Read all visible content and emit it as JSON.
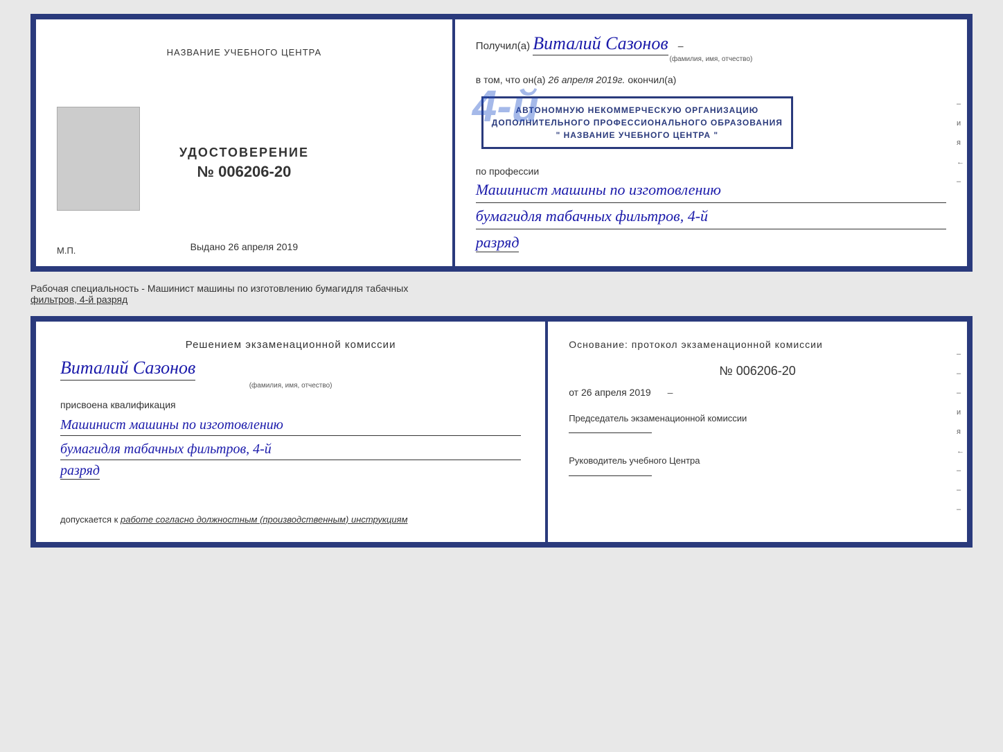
{
  "top": {
    "left": {
      "center_title": "НАЗВАНИЕ УЧЕБНОГО ЦЕНТРА",
      "udostoverenie": "УДОСТОВЕРЕНИЕ",
      "number_prefix": "№",
      "number": "006206-20",
      "issued_label": "Выдано",
      "issued_date": "26 апреля 2019",
      "mp_label": "М.П."
    },
    "right": {
      "poluchil_prefix": "Получил(а)",
      "name": "Виталий Сазонов",
      "fio_label": "(фамилия, имя, отчество)",
      "vtom_prefix": "в том, что он(а)",
      "date_value": "26 апреля 2019г.",
      "okonchil": "окончил(а)",
      "stamp_line1": "АВТОНОМНУЮ НЕКОММЕРЧЕСКУЮ ОРГАНИЗАЦИЮ",
      "stamp_line2": "ДОПОЛНИТЕЛЬНОГО ПРОФЕССИОНАЛЬНОГО ОБРАЗОВАНИЯ",
      "stamp_line3": "\" НАЗВАНИЕ УЧЕБНОГО ЦЕНТРА \"",
      "big_number": "4-й",
      "po_professii": "по профессии",
      "profession_line1": "Машинист машины по изготовлению",
      "profession_line2": "бумагидля табачных фильтров, 4-й",
      "razryad": "разряд",
      "side_chars": [
        "–",
        "и",
        "я",
        "←",
        "–"
      ]
    }
  },
  "bottom_label": {
    "text": "Рабочая специальность - Машинист машины по изготовлению бумагидля табачных",
    "underline_part": "фильтров, 4-й разряд"
  },
  "bottom": {
    "left": {
      "resheniem": "Решением экзаменационной комиссии",
      "name": "Виталий Сазонов",
      "fio_label": "(фамилия, имя, отчество)",
      "prisvoena": "присвоена квалификация",
      "profession_line1": "Машинист машины по изготовлению",
      "profession_line2": "бумагидля табачных фильтров, 4-й",
      "razryad": "разряд",
      "dopusk_prefix": "допускается к",
      "dopusk_text": "работе согласно должностным (производственным) инструкциям"
    },
    "right": {
      "osnование": "Основание: протокол экзаменационной  комиссии",
      "number_prefix": "№",
      "number": "006206-20",
      "ot_prefix": "от",
      "ot_date": "26 апреля 2019",
      "chairman_label": "Председатель экзаменационной комиссии",
      "rukovoditel_label": "Руководитель учебного Центра",
      "side_chars": [
        "–",
        "–",
        "–",
        "и",
        "я",
        "←",
        "–",
        "–",
        "–"
      ]
    }
  }
}
